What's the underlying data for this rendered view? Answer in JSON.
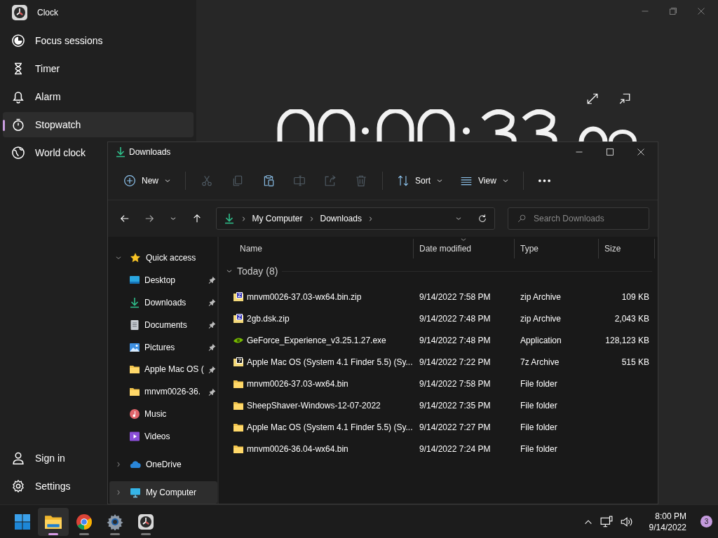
{
  "clock_app": {
    "title": "Clock",
    "nav": [
      {
        "label": "Focus sessions",
        "kind": "focus",
        "selected": false
      },
      {
        "label": "Timer",
        "kind": "timer",
        "selected": false
      },
      {
        "label": "Alarm",
        "kind": "alarm",
        "selected": false
      },
      {
        "label": "Stopwatch",
        "kind": "stopwatch",
        "selected": true
      },
      {
        "label": "World clock",
        "kind": "globe",
        "selected": false
      }
    ],
    "footer_nav": [
      {
        "label": "Sign in",
        "kind": "person"
      },
      {
        "label": "Settings",
        "kind": "gear"
      }
    ]
  },
  "explorer": {
    "title": "Downloads",
    "toolbar": [
      {
        "kind": "new",
        "label": "New",
        "disabled": false
      },
      {
        "kind": "cut",
        "disabled": true
      },
      {
        "kind": "copy",
        "disabled": true
      },
      {
        "kind": "paste",
        "disabled": false
      },
      {
        "kind": "rename",
        "disabled": true
      },
      {
        "kind": "share",
        "disabled": true
      },
      {
        "kind": "delete",
        "disabled": true
      },
      {
        "kind": "sort",
        "label": "Sort",
        "disabled": false
      },
      {
        "kind": "view",
        "label": "View",
        "disabled": false
      },
      {
        "kind": "more"
      }
    ],
    "address": {
      "path": [
        "My Computer",
        "Downloads"
      ]
    },
    "search": {
      "placeholder": "Search Downloads"
    },
    "sidebar": [
      {
        "label": "Quick access",
        "kind": "star",
        "expanded": true,
        "selected": false,
        "children": [
          {
            "label": "Desktop",
            "kind": "desktop",
            "pinned": true,
            "selected": false
          },
          {
            "label": "Downloads",
            "kind": "download",
            "pinned": true,
            "selected": false
          },
          {
            "label": "Documents",
            "kind": "document",
            "pinned": true,
            "selected": false
          },
          {
            "label": "Pictures",
            "kind": "pictures",
            "pinned": true,
            "selected": false
          },
          {
            "label": "Apple Mac OS (",
            "kind": "folder",
            "pinned": true,
            "selected": false
          },
          {
            "label": "mnvm0026-36.",
            "kind": "folder",
            "pinned": true,
            "selected": false
          },
          {
            "label": "Music",
            "kind": "music",
            "pinned": false,
            "selected": false
          },
          {
            "label": "Videos",
            "kind": "videos",
            "pinned": false,
            "selected": false
          }
        ]
      },
      {
        "label": "OneDrive",
        "kind": "cloud",
        "expanded": false,
        "selected": false
      },
      {
        "label": "My Computer",
        "kind": "computer",
        "expanded": false,
        "selected": true
      }
    ],
    "columns": [
      "Name",
      "Date modified",
      "Type",
      "Size"
    ],
    "group": "Today (8)",
    "rows": [
      {
        "kind": "zip",
        "name": "mnvm0026-37.03-wx64.bin.zip",
        "date": "9/14/2022 7:58 PM",
        "type": "zip Archive",
        "size": "109 KB"
      },
      {
        "kind": "zip",
        "name": "2gb.dsk.zip",
        "date": "9/14/2022 7:48 PM",
        "type": "zip Archive",
        "size": "2,043 KB"
      },
      {
        "kind": "exe",
        "name": "GeForce_Experience_v3.25.1.27.exe",
        "date": "9/14/2022 7:48 PM",
        "type": "Application",
        "size": "128,123 KB"
      },
      {
        "kind": "sevenzip",
        "name": "Apple Mac OS (System 4.1 Finder 5.5) (Sy...",
        "date": "9/14/2022 7:22 PM",
        "type": "7z Archive",
        "size": "515 KB"
      },
      {
        "kind": "folder",
        "name": "mnvm0026-37.03-wx64.bin",
        "date": "9/14/2022 7:58 PM",
        "type": "File folder"
      },
      {
        "kind": "folder",
        "name": "SheepShaver-Windows-12-07-2022",
        "date": "9/14/2022 7:35 PM",
        "type": "File folder"
      },
      {
        "kind": "folder",
        "name": "Apple Mac OS (System 4.1 Finder 5.5) (Sy...",
        "date": "9/14/2022 7:27 PM",
        "type": "File folder"
      },
      {
        "kind": "folder",
        "name": "mnvm0026-36.04-wx64.bin",
        "date": "9/14/2022 7:24 PM",
        "type": "File folder"
      }
    ]
  },
  "taskbar": {
    "apps": [
      {
        "kind": "start",
        "selected": false
      },
      {
        "kind": "explorer",
        "selected": true
      },
      {
        "kind": "chrome",
        "selected": false
      },
      {
        "kind": "settings",
        "selected": false
      },
      {
        "kind": "clock",
        "selected": false
      }
    ],
    "time": "8:00 PM",
    "date": "9/14/2022",
    "notifications": "3"
  }
}
